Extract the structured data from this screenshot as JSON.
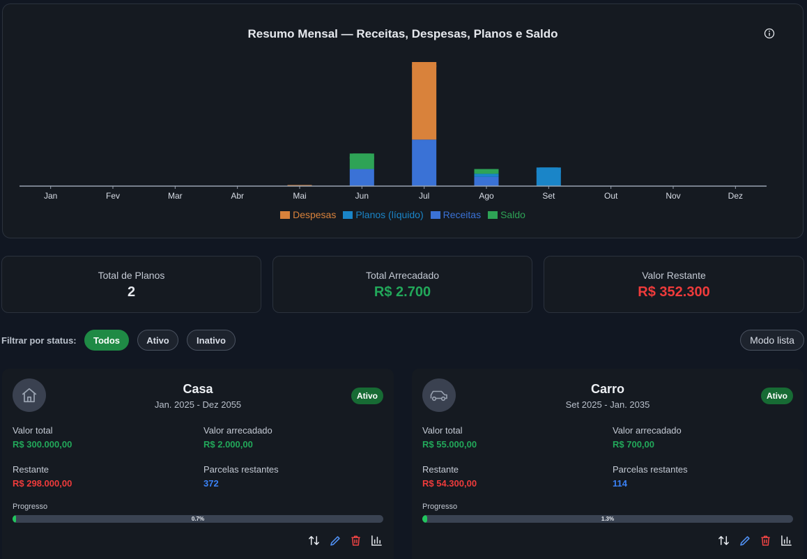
{
  "chart": {
    "title": "Resumo Mensal — Receitas, Despesas, Planos e Saldo",
    "info_icon": "info-icon"
  },
  "chart_data": {
    "type": "bar",
    "stacked": true,
    "title": "Resumo Mensal — Receitas, Despesas, Planos e Saldo",
    "categories": [
      "Jan",
      "Fev",
      "Mar",
      "Abr",
      "Mai",
      "Jun",
      "Jul",
      "Ago",
      "Set",
      "Out",
      "Nov",
      "Dez"
    ],
    "series": [
      {
        "name": "Receitas",
        "color": "#3a72d6",
        "values": [
          0,
          0,
          0,
          0,
          0,
          1100,
          3000,
          600,
          0,
          0,
          0,
          0
        ]
      },
      {
        "name": "Planos (líquido)",
        "color": "#1a85c8",
        "values": [
          0,
          0,
          0,
          0,
          0,
          0,
          0,
          200,
          1200,
          0,
          0,
          0
        ]
      },
      {
        "name": "Saldo",
        "color": "#2ea356",
        "values": [
          0,
          0,
          0,
          0,
          0,
          1000,
          0,
          300,
          0,
          0,
          0,
          0
        ]
      },
      {
        "name": "Despesas",
        "color": "#d9823b",
        "values": [
          0,
          0,
          0,
          0,
          70,
          0,
          5000,
          0,
          0,
          0,
          0,
          0
        ]
      }
    ],
    "ylim": [
      0,
      8000
    ],
    "grid": false,
    "legend_position": "bottom",
    "legend_order": [
      "Despesas",
      "Planos (líquido)",
      "Receitas",
      "Saldo"
    ]
  },
  "stats": {
    "total_planos": {
      "label": "Total de Planos",
      "value": "2"
    },
    "total_arrecadado": {
      "label": "Total Arrecadado",
      "value": "R$ 2.700"
    },
    "valor_restante": {
      "label": "Valor Restante",
      "value": "R$ 352.300"
    }
  },
  "filter": {
    "label": "Filtrar por status:",
    "options": [
      "Todos",
      "Ativo",
      "Inativo"
    ],
    "selected": "Todos",
    "mode_button": "Modo lista"
  },
  "plans": [
    {
      "icon": "home-icon",
      "name": "Casa",
      "dates": "Jan. 2025 - Dez 2055",
      "status": "Ativo",
      "valor_total_label": "Valor total",
      "valor_total": "R$ 300.000,00",
      "valor_arrecadado_label": "Valor arrecadado",
      "valor_arrecadado": "R$ 2.000,00",
      "restante_label": "Restante",
      "restante": "R$ 298.000,00",
      "parcelas_label": "Parcelas restantes",
      "parcelas": "372",
      "progresso_label": "Progresso",
      "progress_fraction": 0.007,
      "progress_text": "0.7%"
    },
    {
      "icon": "car-icon",
      "name": "Carro",
      "dates": "Set 2025 - Jan. 2035",
      "status": "Ativo",
      "valor_total_label": "Valor total",
      "valor_total": "R$ 55.000,00",
      "valor_arrecadado_label": "Valor arrecadado",
      "valor_arrecadado": "R$ 700,00",
      "restante_label": "Restante",
      "restante": "R$ 54.300,00",
      "parcelas_label": "Parcelas restantes",
      "parcelas": "114",
      "progresso_label": "Progresso",
      "progress_fraction": 0.013,
      "progress_text": "1.3%"
    }
  ],
  "colors": {
    "green": "#22a85a",
    "red": "#ef3b3b",
    "blue": "#3b82f6",
    "active_pill": "#1f8a45"
  }
}
